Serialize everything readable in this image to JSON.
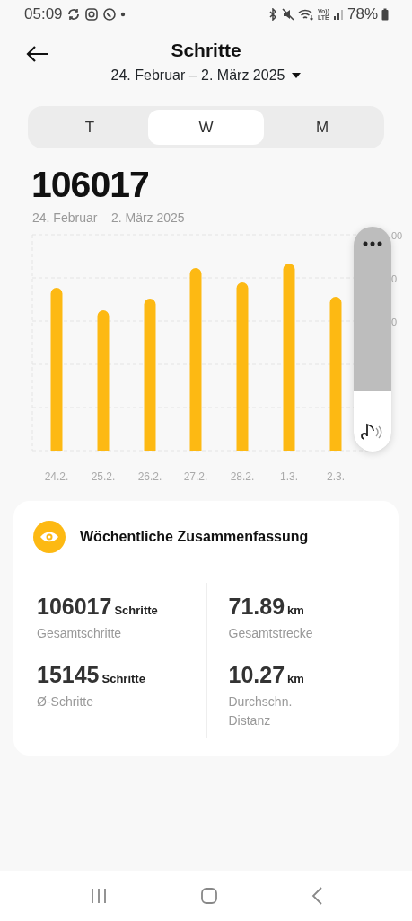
{
  "status_bar": {
    "time": "05:09",
    "network_top": "Vo))",
    "network_bottom": "LTE",
    "battery": "78%"
  },
  "header": {
    "title": "Schritte",
    "date_range": "24. Februar – 2. März 2025"
  },
  "tabs": [
    {
      "label": "T",
      "selected": false
    },
    {
      "label": "W",
      "selected": true
    },
    {
      "label": "M",
      "selected": false
    }
  ],
  "total": {
    "value": "106017",
    "date_range": "24. Februar – 2. März 2025"
  },
  "chart": {
    "x_labels": [
      "24.2.",
      "25.2.",
      "26.2.",
      "27.2.",
      "28.2.",
      "1.3.",
      "2.3."
    ],
    "y_tick_fragments": [
      "00",
      "0",
      "0"
    ]
  },
  "volume_panel": {
    "level": 0.27
  },
  "summary": {
    "title": "Wöchentliche Zusammenfassung",
    "stats": [
      {
        "value": "106017",
        "unit": "Schritte",
        "label": "Gesamtschritte"
      },
      {
        "value": "71.89",
        "unit": "km",
        "label": "Gesamtstrecke"
      },
      {
        "value": "15145",
        "unit": "Schritte",
        "label": "Ø-Schritte"
      },
      {
        "value": "10.27",
        "unit": "km",
        "label": "Durchschn. Distanz"
      }
    ]
  }
}
